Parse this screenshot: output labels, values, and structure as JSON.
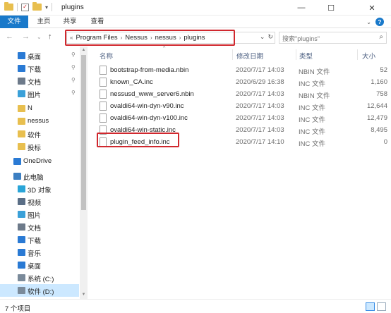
{
  "window": {
    "title": "plugins",
    "minimize": "—",
    "maximize": "☐",
    "close": "✕"
  },
  "ribbon": {
    "tabs": [
      "文件",
      "主页",
      "共享",
      "查看"
    ]
  },
  "address": {
    "prefix": "«",
    "crumbs": [
      "Program Files",
      "Nessus",
      "nessus",
      "plugins"
    ],
    "search_placeholder": "搜索\"plugins\""
  },
  "nav": {
    "items": [
      {
        "label": "桌面",
        "pinned": true,
        "color": "#2a7ad4"
      },
      {
        "label": "下载",
        "pinned": true,
        "color": "#2a7ad4"
      },
      {
        "label": "文档",
        "pinned": true,
        "color": "#6d7a8a"
      },
      {
        "label": "图片",
        "pinned": true,
        "color": "#3aa0d8"
      },
      {
        "label": "N",
        "pinned": false,
        "color": "#e8bf4f"
      },
      {
        "label": "nessus",
        "pinned": false,
        "color": "#e8bf4f"
      },
      {
        "label": "软件",
        "pinned": false,
        "color": "#e8bf4f"
      },
      {
        "label": "投标",
        "pinned": false,
        "color": "#e8bf4f"
      },
      {
        "label": "OneDrive",
        "pinned": false,
        "color": "#2a7ad4"
      },
      {
        "label": "此电脑",
        "pinned": false,
        "color": "#3c7fc2"
      },
      {
        "label": "3D 对象",
        "pinned": false,
        "color": "#2aa5d8"
      },
      {
        "label": "视频",
        "pinned": false,
        "color": "#5a6e86"
      },
      {
        "label": "图片",
        "pinned": false,
        "color": "#3aa0d8"
      },
      {
        "label": "文档",
        "pinned": false,
        "color": "#6d7a8a"
      },
      {
        "label": "下载",
        "pinned": false,
        "color": "#2a7ad4"
      },
      {
        "label": "音乐",
        "pinned": false,
        "color": "#2a7ad4"
      },
      {
        "label": "桌面",
        "pinned": false,
        "color": "#2a7ad4"
      },
      {
        "label": "系统 (C:)",
        "pinned": false,
        "color": "#7a8a9a"
      },
      {
        "label": "软件 (D:)",
        "pinned": false,
        "color": "#7a8a9a"
      }
    ],
    "pin_glyph": "📌"
  },
  "columns": {
    "name": "名称",
    "date": "修改日期",
    "type": "类型",
    "size": "大小"
  },
  "files": [
    {
      "name": "bootstrap-from-media.nbin",
      "date": "2020/7/17 14:03",
      "type": "NBIN 文件",
      "size": "52"
    },
    {
      "name": "known_CA.inc",
      "date": "2020/6/29 16:38",
      "type": "INC 文件",
      "size": "1,160"
    },
    {
      "name": "nessusd_www_server6.nbin",
      "date": "2020/7/17 14:03",
      "type": "NBIN 文件",
      "size": "758"
    },
    {
      "name": "ovaldi64-win-dyn-v90.inc",
      "date": "2020/7/17 14:03",
      "type": "INC 文件",
      "size": "12,644"
    },
    {
      "name": "ovaldi64-win-dyn-v100.inc",
      "date": "2020/7/17 14:03",
      "type": "INC 文件",
      "size": "12,479"
    },
    {
      "name": "ovaldi64-win-static.inc",
      "date": "2020/7/17 14:03",
      "type": "INC 文件",
      "size": "8,495"
    },
    {
      "name": "plugin_feed_info.inc",
      "date": "2020/7/17 14:10",
      "type": "INC 文件",
      "size": "0"
    }
  ],
  "status": {
    "count_text": "7 个项目"
  },
  "colors": {
    "accent": "#1979ca",
    "highlight_box": "#d0282e",
    "selected_bg": "#cce8ff"
  }
}
